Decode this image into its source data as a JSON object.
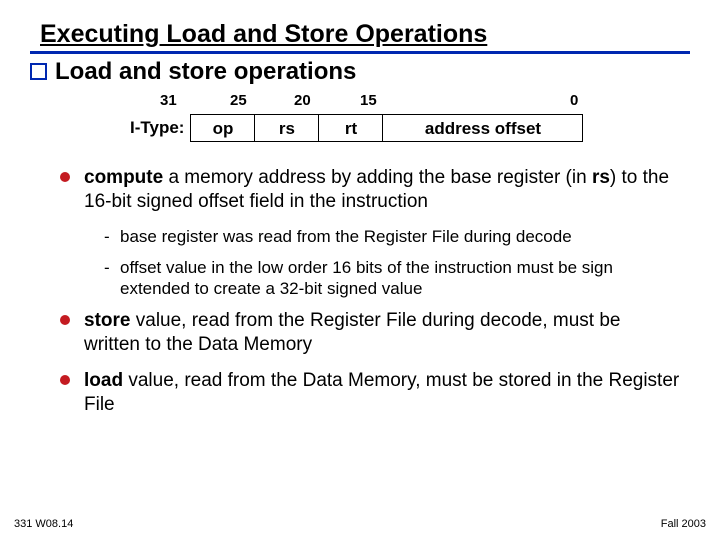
{
  "title": "Executing Load and Store Operations",
  "subtitle": "Load and store operations",
  "format": {
    "label": "I-Type:",
    "ticks": {
      "t31": "31",
      "t25": "25",
      "t20": "20",
      "t15": "15",
      "t0": "0"
    },
    "fields": {
      "op": "op",
      "rs": "rs",
      "rt": "rt",
      "offset": "address offset"
    }
  },
  "bullets": {
    "b1_pre": "compute ",
    "b1_mid1": "a memory address by adding the base register (in ",
    "b1_rs": "rs",
    "b1_mid2": ") to the 16-bit signed offset field in the instruction",
    "b1a": "base register was read from the Register File during decode",
    "b1b": "offset value in the low order 16 bits of the instruction must be sign extended to create a 32-bit signed value",
    "b2_pre": "store ",
    "b2_rest": "value, read from the Register File during decode, must be written to the Data Memory",
    "b3_pre": "load ",
    "b3_rest": "value, read from the Data Memory, must be stored in the Register File"
  },
  "footer": {
    "left": "331 W08.14",
    "right": "Fall 2003"
  }
}
